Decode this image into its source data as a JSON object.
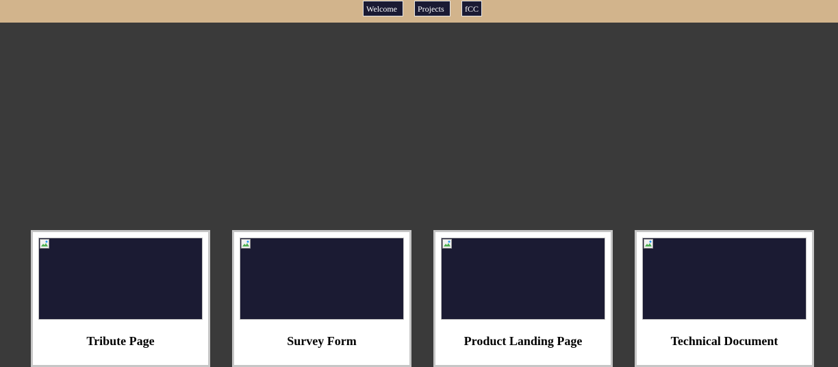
{
  "nav": {
    "links": [
      {
        "label": "Welcome"
      },
      {
        "label": "Projects"
      },
      {
        "label": "fCC"
      }
    ]
  },
  "projects": [
    {
      "title": "Tribute Page",
      "image_icon": "broken-image-icon"
    },
    {
      "title": "Survey Form",
      "image_icon": "broken-image-icon"
    },
    {
      "title": "Product Landing Page",
      "image_icon": "broken-image-icon"
    },
    {
      "title": "Technical Document",
      "image_icon": "broken-image-icon"
    }
  ],
  "colors": {
    "navbar_bg": "#d2b48c",
    "nav_link_bg": "#1a1a33",
    "page_bg": "#3a3a3a",
    "card_bg": "#ffffff",
    "image_bg": "#1b1b33"
  }
}
